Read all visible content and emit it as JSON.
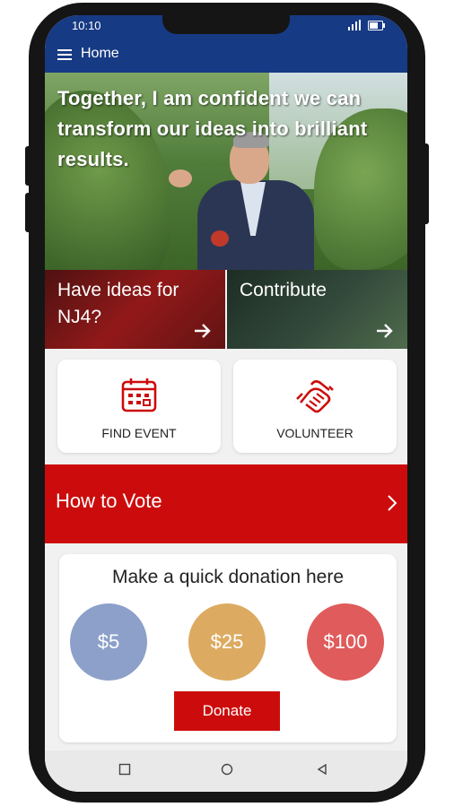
{
  "status": {
    "time": "10:10"
  },
  "header": {
    "title": "Home"
  },
  "hero": {
    "quote": "Together, I am confident we can transform our ideas into brilliant results."
  },
  "tiles": [
    {
      "label": "Have ideas for NJ4?",
      "icon": "arrow-right-icon"
    },
    {
      "label": "Contribute",
      "icon": "arrow-right-icon"
    }
  ],
  "actions": [
    {
      "label": "FIND EVENT",
      "icon": "calendar-icon"
    },
    {
      "label": "VOLUNTEER",
      "icon": "handshake-icon"
    }
  ],
  "vote": {
    "label": "How to Vote",
    "icon": "chevron-right-icon"
  },
  "donation": {
    "heading": "Make a quick donation here",
    "amounts": [
      {
        "label": "$5",
        "color": "#8ca0c9"
      },
      {
        "label": "$25",
        "color": "#dcab61"
      },
      {
        "label": "$100",
        "color": "#e05b5b"
      }
    ],
    "button": "Donate"
  },
  "colors": {
    "brand_blue": "#173a84",
    "brand_red": "#cc0c0c"
  },
  "system_nav": [
    "square-icon",
    "circle-icon",
    "back-triangle-icon"
  ]
}
